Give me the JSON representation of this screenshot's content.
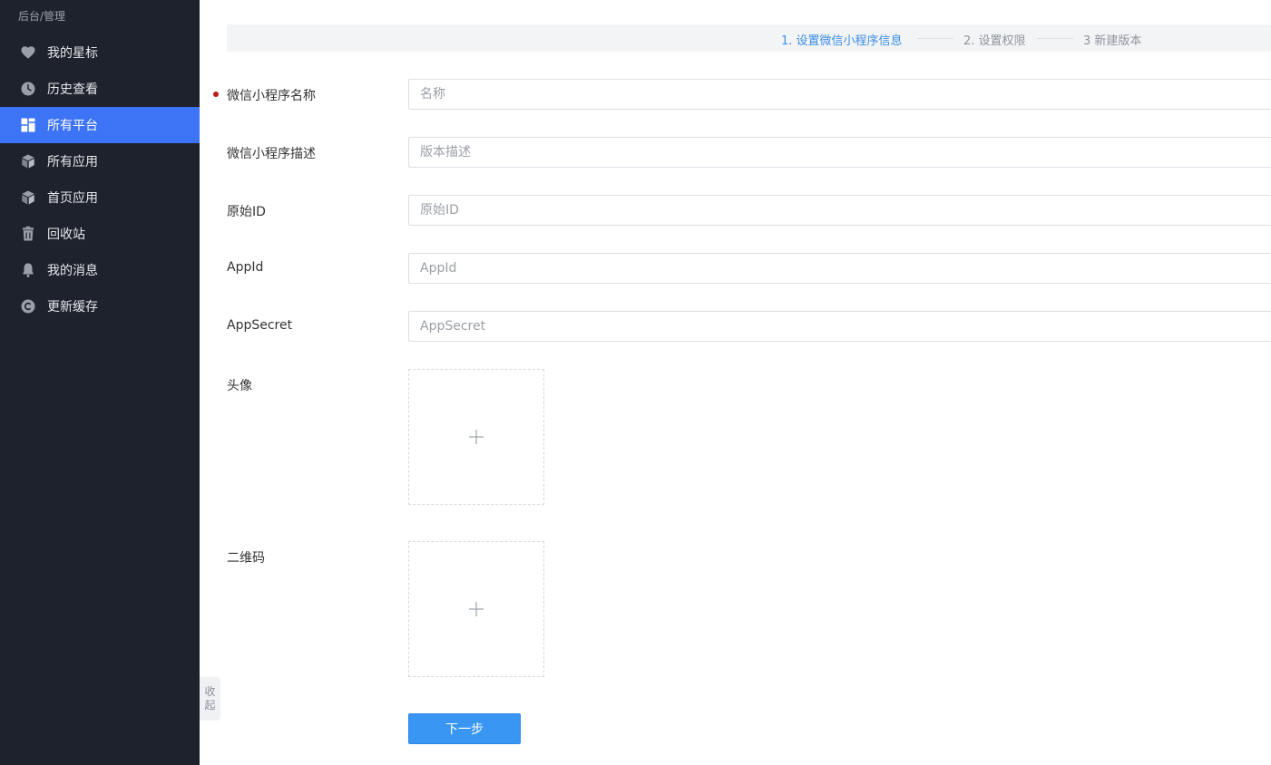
{
  "sidebar": {
    "breadcrumb": "后台/管理",
    "items": [
      {
        "label": "我的星标",
        "icon": "heart-icon"
      },
      {
        "label": "历史查看",
        "icon": "clock-icon"
      },
      {
        "label": "所有平台",
        "icon": "grid-icon",
        "active": true
      },
      {
        "label": "所有应用",
        "icon": "cube-icon"
      },
      {
        "label": "首页应用",
        "icon": "cube-icon"
      },
      {
        "label": "回收站",
        "icon": "trash-icon"
      },
      {
        "label": "我的消息",
        "icon": "bell-icon"
      },
      {
        "label": "更新缓存",
        "icon": "refresh-circle-icon"
      }
    ],
    "collapse_label": [
      "收",
      "起"
    ]
  },
  "steps": [
    {
      "label": "1. 设置微信小程序信息",
      "active": true
    },
    {
      "label": "2. 设置权限",
      "active": false
    },
    {
      "label": "3 新建版本",
      "active": false
    }
  ],
  "form": {
    "name": {
      "label": "微信小程序名称",
      "placeholder": "名称",
      "required": true
    },
    "description": {
      "label": "微信小程序描述",
      "placeholder": "版本描述"
    },
    "original_id": {
      "label": "原始ID",
      "placeholder": "原始ID"
    },
    "app_id": {
      "label": "AppId",
      "placeholder": "AppId"
    },
    "app_secret": {
      "label": "AppSecret",
      "placeholder": "AppSecret"
    },
    "avatar": {
      "label": "头像"
    },
    "qrcode": {
      "label": "二维码"
    },
    "next_label": "下一步"
  },
  "colors": {
    "sidebar_bg": "#1e222d",
    "active_nav": "#3d73f5",
    "accent": "#3a8ee6",
    "button": "#3a96f3",
    "required": "#c0181b"
  }
}
